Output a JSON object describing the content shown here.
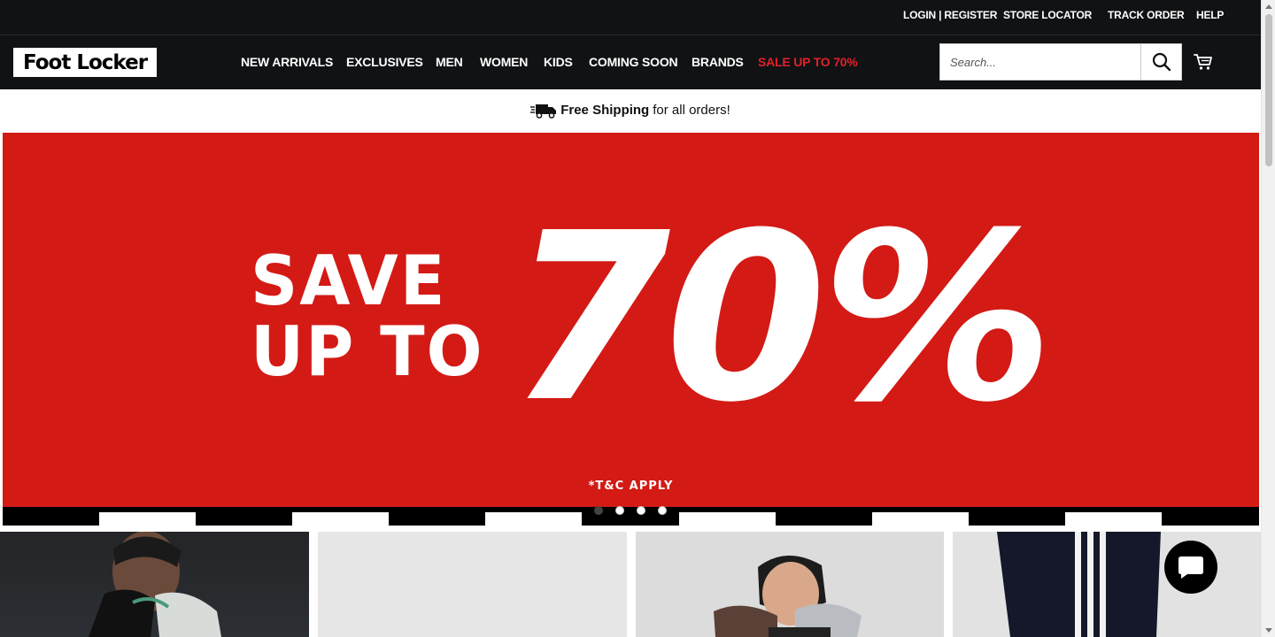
{
  "util_nav": {
    "login_register": "LOGIN | REGISTER",
    "store_locator": "STORE LOCATOR",
    "track_order": "TRACK ORDER",
    "help": "HELP"
  },
  "brand": {
    "logo_text": "Foot Locker"
  },
  "main_nav": {
    "new_arrivals": "NEW ARRIVALS",
    "exclusives": "EXCLUSIVES",
    "men": "MEN",
    "women": "WOMEN",
    "kids": "KIDS",
    "coming_soon": "COMING SOON",
    "brands": "BRANDS",
    "sale": "SALE UP TO 70%"
  },
  "search": {
    "placeholder": "Search...",
    "icon": "search-icon"
  },
  "cart": {
    "icon": "cart-icon"
  },
  "shipping": {
    "bold": "Free Shipping",
    "rest": "for all orders!",
    "icon": "truck-icon"
  },
  "hero": {
    "line1": "SAVE",
    "line2": "UP TO",
    "big": "70%",
    "terms": "*T&C APPLY",
    "slides": 4,
    "active_slide": 1
  },
  "tiles": [
    {
      "name": "category-tile-1"
    },
    {
      "name": "category-tile-2"
    },
    {
      "name": "category-tile-3"
    },
    {
      "name": "category-tile-4"
    }
  ],
  "chat": {
    "icon": "chat-bubble-icon"
  },
  "colors": {
    "header_bg": "#101214",
    "sale_red": "#e2202a",
    "hero_red": "#d31a15"
  }
}
